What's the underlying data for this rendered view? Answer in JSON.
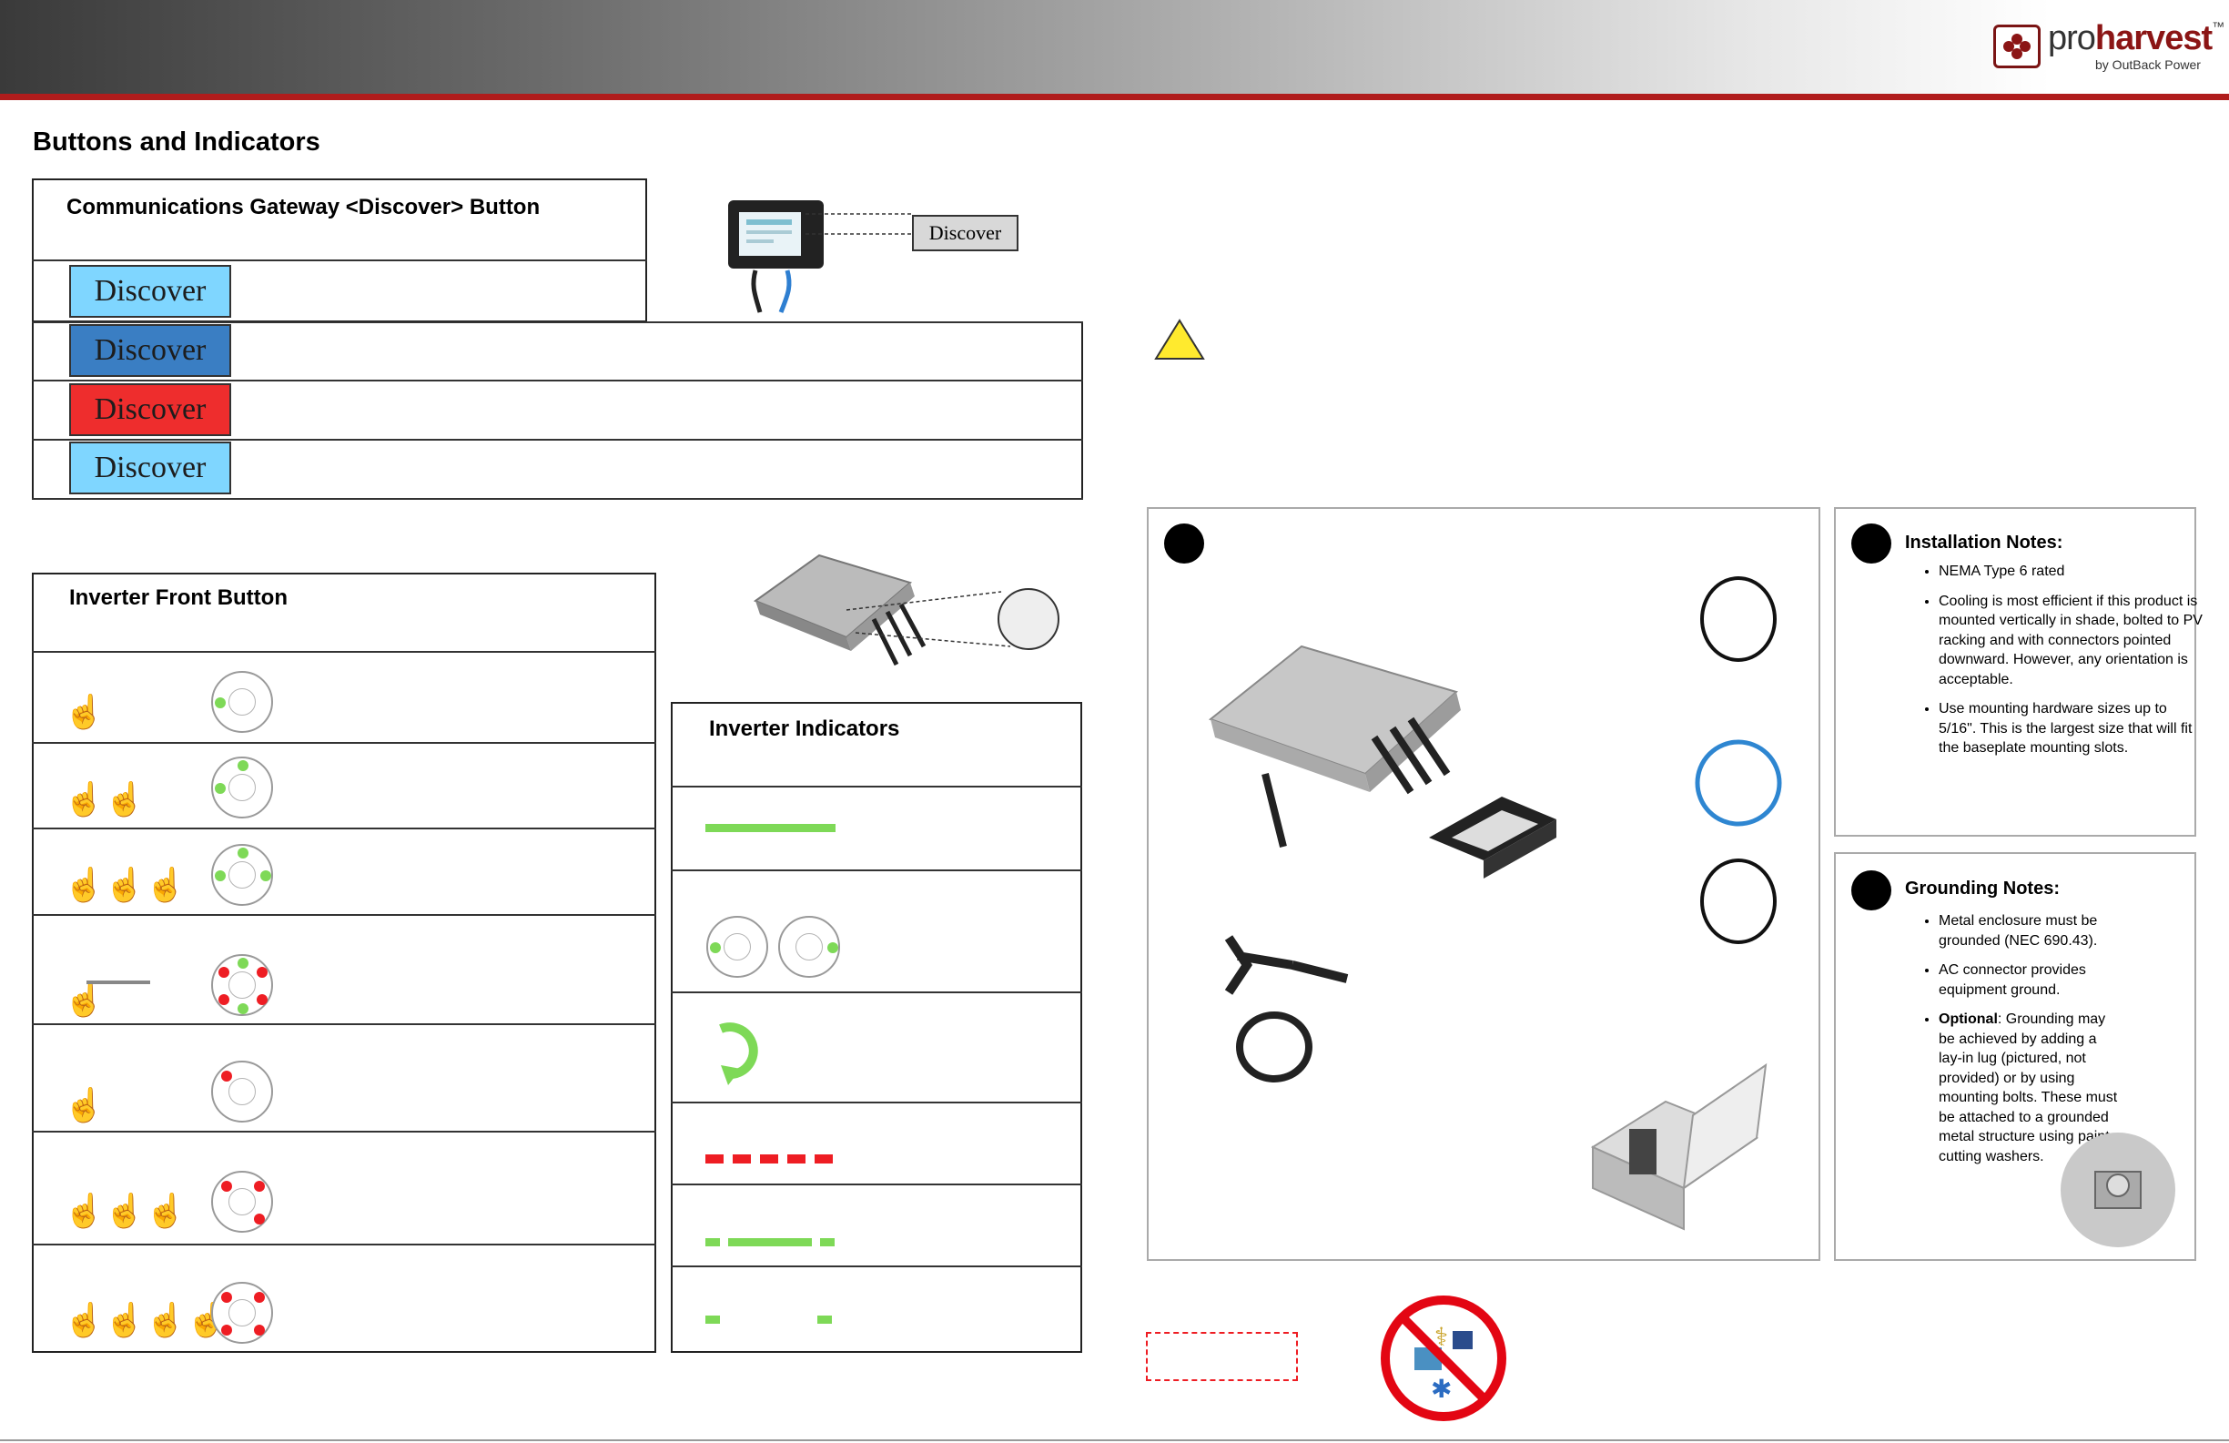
{
  "brand": {
    "logo_main": "pro",
    "logo_bold": "harvest",
    "logo_tm": "™",
    "logo_sub": "by OutBack Power"
  },
  "page_title": "Buttons and Indicators",
  "gateway": {
    "title": "Communications Gateway <Discover> Button",
    "callout": "Discover",
    "states": [
      {
        "label": "Discover",
        "color": "#7fd6ff"
      },
      {
        "label": "Discover",
        "color": "#3a7ec3"
      },
      {
        "label": "Discover",
        "color": "#ee2d2d"
      },
      {
        "label": "Discover",
        "color": "#7fd6ff"
      }
    ]
  },
  "inverter_button": {
    "title": "Inverter Front Button",
    "rows": 7
  },
  "inverter_indicators": {
    "title": "Inverter Indicators",
    "green": "#7ed957",
    "red": "#ee1d23"
  },
  "notes": {
    "installation": {
      "title": "Installation Notes:",
      "items": [
        "NEMA Type 6 rated",
        "Cooling is most efficient if this product is mounted vertically in shade, bolted to PV racking and with connectors pointed downward.  However, any orientation is acceptable.",
        "Use mounting hardware sizes up to 5/16\".  This is the largest size that will fit the baseplate mounting slots."
      ]
    },
    "grounding": {
      "title": "Grounding Notes:",
      "items": [
        "Metal enclosure must be grounded (NEC 690.43).",
        "AC connector provides equipment ground."
      ],
      "optional_label": "Optional",
      "optional_text": ":  Grounding may be achieved by adding a lay-in lug (pictured, not provided) or by using mounting bolts. These must be attached to a grounded metal structure using paint-cutting washers."
    }
  }
}
